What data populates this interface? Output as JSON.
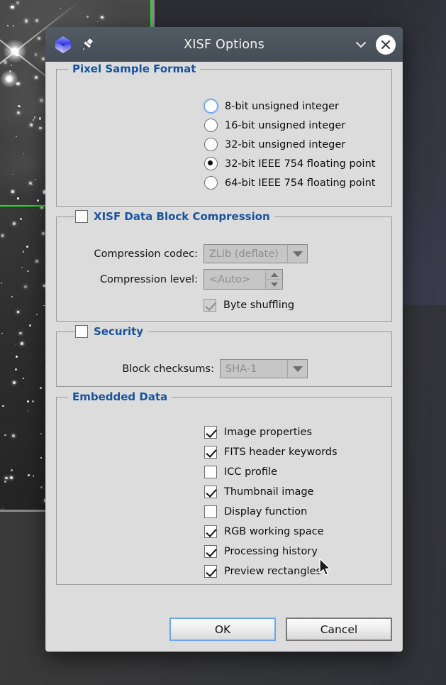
{
  "window": {
    "title": "XISF Options",
    "app_icon": "cube-icon",
    "pin_icon": "pin-icon",
    "shade_icon": "chevron-down-icon",
    "close_icon": "close-icon"
  },
  "colors": {
    "legend_blue": "#18539d",
    "titlebar": "#4b545c",
    "body": "#dcdcdc",
    "focus_blue": "#6aa6f0"
  },
  "pixel_sample_format": {
    "legend": "Pixel Sample Format",
    "options": [
      {
        "label": "8-bit unsigned integer",
        "selected": false,
        "focused": true
      },
      {
        "label": "16-bit unsigned integer",
        "selected": false,
        "focused": false
      },
      {
        "label": "32-bit unsigned integer",
        "selected": false,
        "focused": false
      },
      {
        "label": "32-bit IEEE 754 floating point",
        "selected": true,
        "focused": false
      },
      {
        "label": "64-bit IEEE 754 floating point",
        "selected": false,
        "focused": false
      }
    ]
  },
  "compression": {
    "legend": "XISF Data Block Compression",
    "enabled": false,
    "codec_label": "Compression codec:",
    "codec_value": "ZLib (deflate)",
    "level_label": "Compression level:",
    "level_value": "<Auto>",
    "byte_shuffling_label": "Byte shuffling",
    "byte_shuffling_checked": true
  },
  "security": {
    "legend": "Security",
    "enabled": false,
    "checksums_label": "Block checksums:",
    "checksums_value": "SHA-1"
  },
  "embedded_data": {
    "legend": "Embedded Data",
    "items": [
      {
        "label": "Image properties",
        "checked": true
      },
      {
        "label": "FITS header keywords",
        "checked": true
      },
      {
        "label": "ICC profile",
        "checked": false
      },
      {
        "label": "Thumbnail image",
        "checked": true
      },
      {
        "label": "Display function",
        "checked": false
      },
      {
        "label": "RGB working space",
        "checked": true
      },
      {
        "label": "Processing history",
        "checked": true
      },
      {
        "label": "Preview rectangles",
        "checked": true
      }
    ]
  },
  "buttons": {
    "ok": "OK",
    "cancel": "Cancel"
  }
}
